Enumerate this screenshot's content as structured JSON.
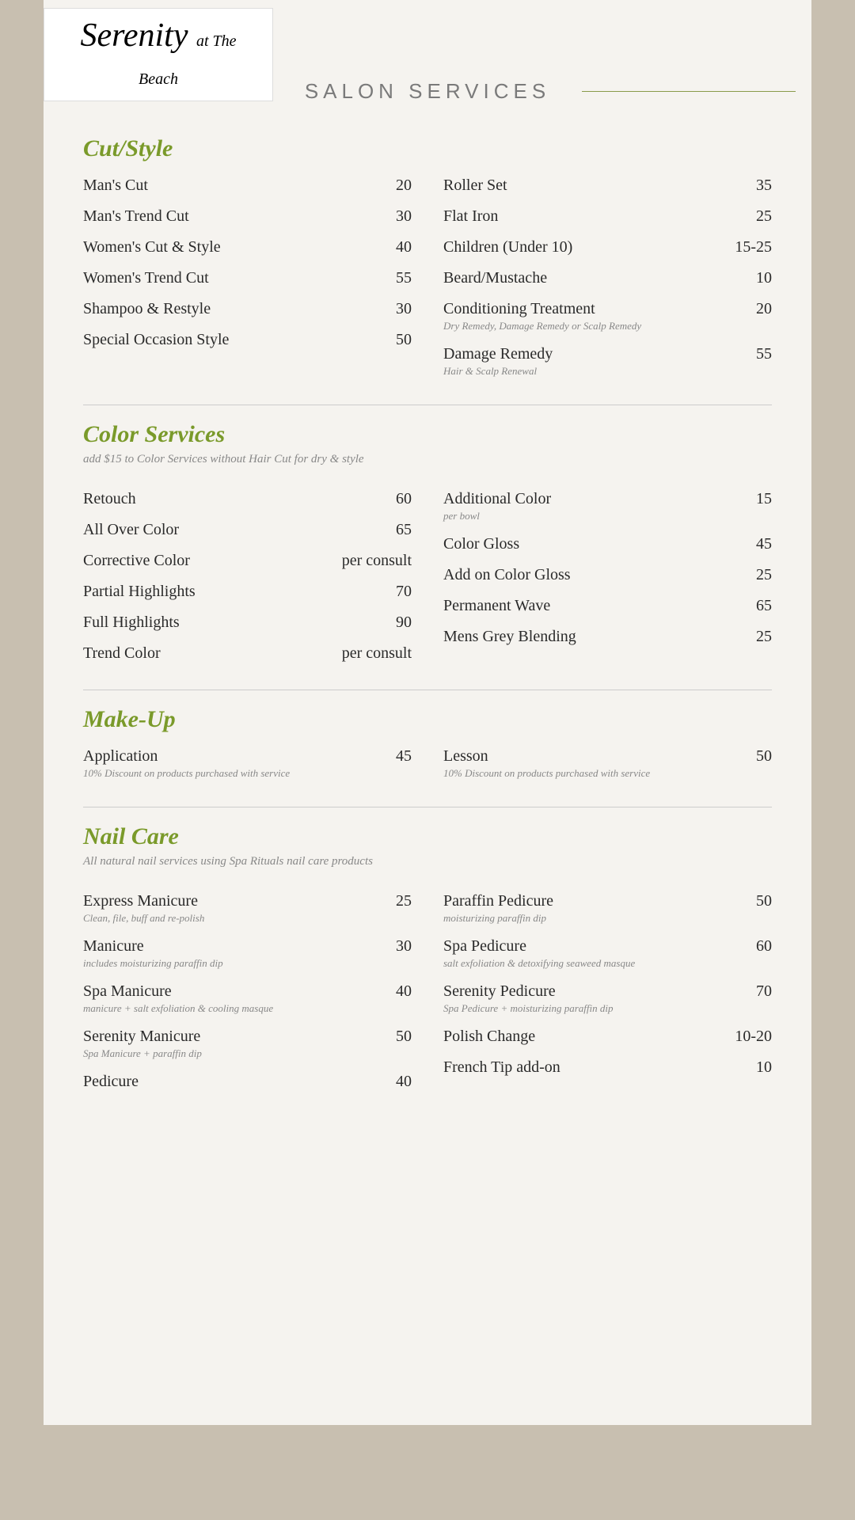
{
  "logo": {
    "name": "Serenity",
    "tagline": "at The Beach"
  },
  "header": {
    "title": "SALON SERVICES"
  },
  "sections": [
    {
      "id": "cut-style",
      "title": "Cut/Style",
      "note": "",
      "left_items": [
        {
          "name": "Man's Cut",
          "price": "20",
          "sub": ""
        },
        {
          "name": "Man's Trend Cut",
          "price": "30",
          "sub": ""
        },
        {
          "name": "Women's Cut & Style",
          "price": "40",
          "sub": ""
        },
        {
          "name": "Women's Trend Cut",
          "price": "55",
          "sub": ""
        },
        {
          "name": "Shampoo & Restyle",
          "price": "30",
          "sub": ""
        },
        {
          "name": "Special Occasion Style",
          "price": "50",
          "sub": ""
        }
      ],
      "right_items": [
        {
          "name": "Roller Set",
          "price": "35",
          "sub": ""
        },
        {
          "name": "Flat Iron",
          "price": "25",
          "sub": ""
        },
        {
          "name": "Children (Under 10)",
          "price": "15-25",
          "sub": ""
        },
        {
          "name": "Beard/Mustache",
          "price": "10",
          "sub": ""
        },
        {
          "name": "Conditioning Treatment",
          "price": "20",
          "sub": "Dry Remedy, Damage Remedy or Scalp Remedy"
        },
        {
          "name": "Damage Remedy",
          "price": "55",
          "sub": "Hair & Scalp Renewal"
        }
      ]
    },
    {
      "id": "color-services",
      "title": "Color Services",
      "note": "add $15 to Color Services without Hair Cut for dry & style",
      "left_items": [
        {
          "name": "Retouch",
          "price": "60",
          "sub": ""
        },
        {
          "name": "All Over Color",
          "price": "65",
          "sub": ""
        },
        {
          "name": "Corrective Color",
          "price": "per consult",
          "sub": ""
        },
        {
          "name": "Partial Highlights",
          "price": "70",
          "sub": ""
        },
        {
          "name": "Full Highlights",
          "price": "90",
          "sub": ""
        },
        {
          "name": "Trend Color",
          "price": "per consult",
          "sub": ""
        }
      ],
      "right_items": [
        {
          "name": "Additional Color",
          "price": "15",
          "sub": "per bowl"
        },
        {
          "name": "Color Gloss",
          "price": "45",
          "sub": ""
        },
        {
          "name": "Add on Color Gloss",
          "price": "25",
          "sub": ""
        },
        {
          "name": "Permanent Wave",
          "price": "65",
          "sub": ""
        },
        {
          "name": "Mens Grey Blending",
          "price": "25",
          "sub": ""
        }
      ]
    },
    {
      "id": "make-up",
      "title": "Make-Up",
      "note": "",
      "left_items": [
        {
          "name": "Application",
          "price": "45",
          "sub": "10% Discount on products purchased with service"
        }
      ],
      "right_items": [
        {
          "name": "Lesson",
          "price": "50",
          "sub": "10% Discount on products purchased with service"
        }
      ]
    },
    {
      "id": "nail-care",
      "title": "Nail Care",
      "note": "All natural nail services using Spa Rituals nail care products",
      "left_items": [
        {
          "name": "Express Manicure",
          "price": "25",
          "sub": "Clean, file, buff and re-polish"
        },
        {
          "name": "Manicure",
          "price": "30",
          "sub": "includes moisturizing paraffin dip"
        },
        {
          "name": "Spa Manicure",
          "price": "40",
          "sub": "manicure + salt exfoliation & cooling masque"
        },
        {
          "name": "Serenity Manicure",
          "price": "50",
          "sub": "Spa Manicure + paraffin dip"
        },
        {
          "name": "Pedicure",
          "price": "40",
          "sub": ""
        }
      ],
      "right_items": [
        {
          "name": "Paraffin Pedicure",
          "price": "50",
          "sub": "moisturizing paraffin dip"
        },
        {
          "name": "Spa Pedicure",
          "price": "60",
          "sub": "salt exfoliation & detoxifying seaweed masque"
        },
        {
          "name": "Serenity Pedicure",
          "price": "70",
          "sub": "Spa Pedicure + moisturizing paraffin dip"
        },
        {
          "name": "Polish Change",
          "price": "10-20",
          "sub": ""
        },
        {
          "name": "French Tip add-on",
          "price": "10",
          "sub": ""
        }
      ]
    }
  ]
}
